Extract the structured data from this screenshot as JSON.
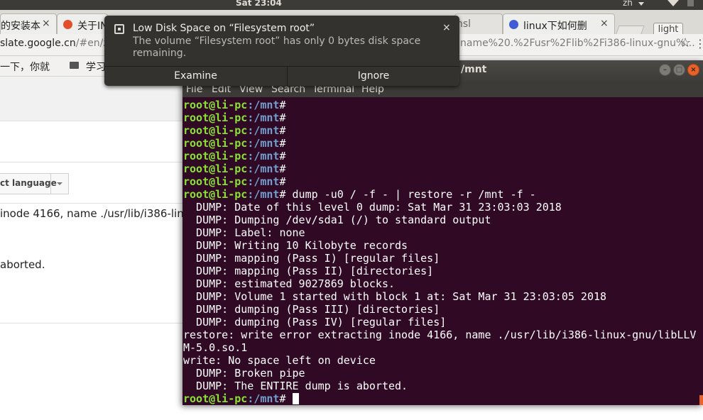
{
  "panel": {
    "clock": "Sat 23:04",
    "keyboard": "zh"
  },
  "tabs": [
    {
      "label": "的安装本",
      "close": "×"
    },
    {
      "label": "关于IN",
      "close": "×"
    },
    {
      "label": "nsl",
      "close": ""
    },
    {
      "label": "linux下如何删",
      "close": "×"
    }
  ],
  "tabbar": {
    "light_label": "light"
  },
  "omnibox": {
    "url_left_prefix": "slate.google.cn",
    "url_left_suffix": "/#en/zh",
    "url_right": "name%20.%2Fusr%2Flib%2Fi386-linux-gnu%..."
  },
  "bookmarks": {
    "item1": "一下，你就",
    "item2": "学习"
  },
  "translate": {
    "language_label": "ct language",
    "source_line1": "inode 4166, name ./usr/lib/i386-linux-",
    "source_line2": "aborted."
  },
  "notification": {
    "title": "Low Disk Space on “Filesystem root”",
    "body": "The volume “Filesystem root” has only 0 bytes disk space remaining.",
    "close": "×",
    "examine": "Examine",
    "ignore": "Ignore"
  },
  "terminal": {
    "title": "/mnt",
    "menu": [
      "File",
      "Edit",
      "View",
      "Search",
      "Terminal",
      "Help"
    ],
    "prompt_user": "root@li-pc",
    "prompt_path": ":/mnt",
    "prompt_hash": "#",
    "command": " dump -u0 / -f - | restore -r /mnt -f -",
    "output": [
      "  DUMP: Date of this level 0 dump: Sat Mar 31 23:03:03 2018",
      "  DUMP: Dumping /dev/sda1 (/) to standard output",
      "  DUMP: Label: none",
      "  DUMP: Writing 10 Kilobyte records",
      "  DUMP: mapping (Pass I) [regular files]",
      "  DUMP: mapping (Pass II) [directories]",
      "  DUMP: estimated 9027869 blocks.",
      "  DUMP: Volume 1 started with block 1 at: Sat Mar 31 23:03:05 2018",
      "  DUMP: dumping (Pass III) [directories]",
      "  DUMP: dumping (Pass IV) [regular files]",
      "restore: write error extracting inode 4166, name ./usr/lib/i386-linux-gnu/libLLV",
      "M-5.0.so.1",
      "write: No space left on device",
      "  DUMP: Broken pipe",
      "  DUMP: The ENTIRE dump is aborted."
    ]
  },
  "colors": {
    "terminal_bg": "#300a24",
    "prompt_user": "#8ae234",
    "prompt_path": "#729fcf",
    "panel": "#3c3b37"
  }
}
